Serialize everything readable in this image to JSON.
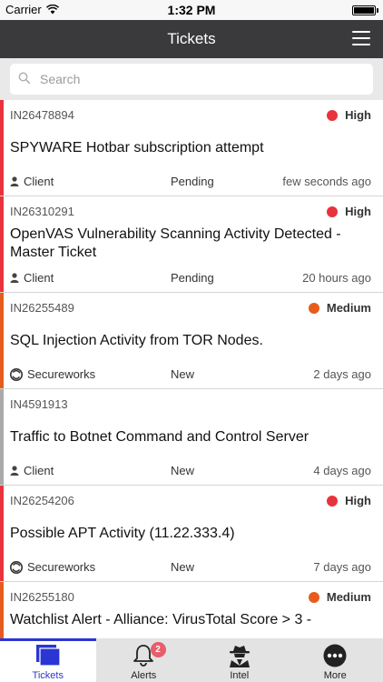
{
  "status_bar": {
    "carrier": "Carrier",
    "time": "1:32 PM"
  },
  "header": {
    "title": "Tickets"
  },
  "search": {
    "placeholder": "Search"
  },
  "colors": {
    "high": "#e8333c",
    "medium": "#e65c1c",
    "none": "#aaaaaa",
    "accent": "#2a36d4"
  },
  "tickets": [
    {
      "id": "IN26478894",
      "priority": "High",
      "priority_level": "high",
      "title": "SPYWARE Hotbar subscription attempt",
      "owner": "Client",
      "owner_icon": "person-icon",
      "status": "Pending",
      "time": "few seconds ago"
    },
    {
      "id": "IN26310291",
      "priority": "High",
      "priority_level": "high",
      "title": "OpenVAS Vulnerability Scanning Activity Detected - Master Ticket",
      "owner": "Client",
      "owner_icon": "person-icon",
      "status": "Pending",
      "time": "20 hours ago"
    },
    {
      "id": "IN26255489",
      "priority": "Medium",
      "priority_level": "medium",
      "title": "SQL Injection Activity from TOR Nodes.",
      "owner": "Secureworks",
      "owner_icon": "secureworks-logo-icon",
      "status": "New",
      "time": "2 days ago"
    },
    {
      "id": "IN4591913",
      "priority": "",
      "priority_level": "none",
      "title": "Traffic to Botnet Command and Control Server",
      "owner": "Client",
      "owner_icon": "person-icon",
      "status": "New",
      "time": "4 days ago"
    },
    {
      "id": "IN26254206",
      "priority": "High",
      "priority_level": "high",
      "title": "Possible APT Activity (11.22.333.4)",
      "owner": "Secureworks",
      "owner_icon": "secureworks-logo-icon",
      "status": "New",
      "time": "7 days ago"
    },
    {
      "id": "IN26255180",
      "priority": "Medium",
      "priority_level": "medium",
      "title": "Watchlist Alert - Alliance: VirusTotal Score > 3 -",
      "owner": "",
      "owner_icon": "",
      "status": "",
      "time": ""
    }
  ],
  "tab_bar": {
    "tabs": [
      {
        "label": "Tickets",
        "icon": "tickets-icon",
        "active": true
      },
      {
        "label": "Alerts",
        "icon": "bell-icon",
        "badge": "2"
      },
      {
        "label": "Intel",
        "icon": "spy-icon"
      },
      {
        "label": "More",
        "icon": "more-dots-icon"
      }
    ]
  }
}
